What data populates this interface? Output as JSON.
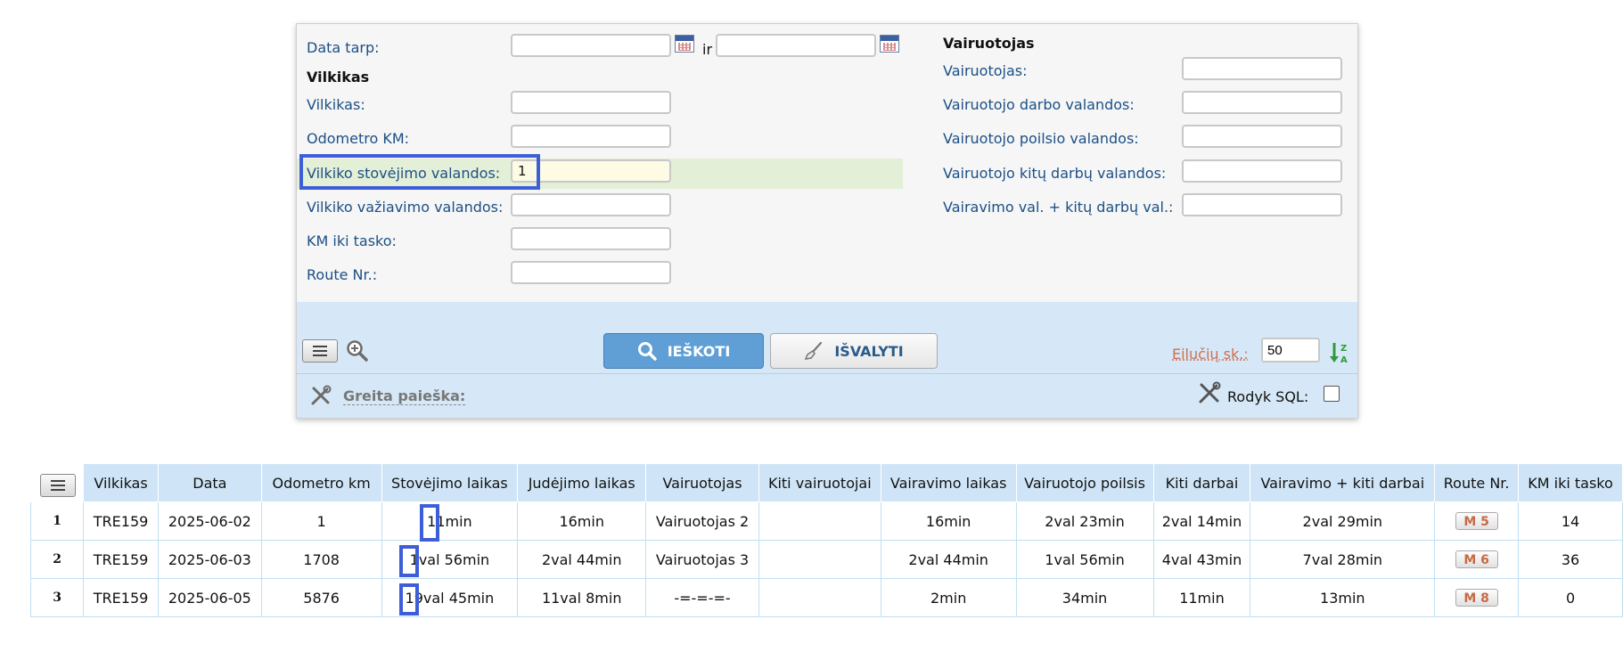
{
  "filters": {
    "date_between_label": "Data tarp:",
    "date_and_label": "ir",
    "date_from_value": "",
    "date_to_value": "",
    "truck_section": "Vilkikas",
    "truck_label": "Vilkikas:",
    "odometer_label": "Odometro KM:",
    "parking_hours_label": "Vilkiko stovėjimo valandos:",
    "parking_hours_value": "1",
    "driving_hours_label": "Vilkiko važiavimo valandos:",
    "km_to_point_label": "KM iki tasko:",
    "route_label": "Route Nr.:",
    "driver_section": "Vairuotojas",
    "driver_label": "Vairuotojas:",
    "driver_work_label": "Vairuotojo darbo valandos:",
    "driver_rest_label": "Vairuotojo poilsio valandos:",
    "driver_other_label": "Vairuotojo kitų darbų valandos:",
    "driving_plus_other_label": "Vairavimo val. + kitų darbų val.:"
  },
  "toolbar": {
    "search_label": "IEŠKOTI",
    "clear_label": "IŠVALYTI",
    "rows_label": "Eilučių sk.:",
    "rows_value": "50",
    "quick_search_label": "Greita paieška:",
    "show_sql_label": "Rodyk SQL:"
  },
  "table": {
    "headers": [
      "Vilkikas",
      "Data",
      "Odometro km",
      "Stovėjimo laikas",
      "Judėjimo laikas",
      "Vairuotojas",
      "Kiti vairuotojai",
      "Vairavimo laikas",
      "Vairuotojo poilsis",
      "Kiti darbai",
      "Vairavimo + kiti darbai",
      "Route Nr.",
      "KM iki tasko"
    ],
    "rows": [
      {
        "num": "1",
        "truck": "TRE159",
        "date": "2025-06-02",
        "odometer": "1",
        "parking": "11min",
        "moving": "16min",
        "driver": "Vairuotojas 2",
        "other_drivers": "",
        "driving": "16min",
        "rest": "2val 23min",
        "other_work": "2val 14min",
        "drive_plus_other": "2val 29min",
        "route": "M 5",
        "km_to_point": "14"
      },
      {
        "num": "2",
        "truck": "TRE159",
        "date": "2025-06-03",
        "odometer": "1708",
        "parking": "1val 56min",
        "moving": "2val 44min",
        "driver": "Vairuotojas 3",
        "other_drivers": "",
        "driving": "2val 44min",
        "rest": "1val 56min",
        "other_work": "4val 43min",
        "drive_plus_other": "7val 28min",
        "route": "M 6",
        "km_to_point": "36"
      },
      {
        "num": "3",
        "truck": "TRE159",
        "date": "2025-06-05",
        "odometer": "5876",
        "parking": "19val 45min",
        "moving": "11val 8min",
        "driver": "-=-=-=-",
        "other_drivers": "",
        "driving": "2min",
        "rest": "34min",
        "other_work": "11min",
        "drive_plus_other": "13min",
        "route": "M 8",
        "km_to_point": "0"
      }
    ]
  },
  "icons": {
    "menu": "hamburger-icon",
    "zoom": "zoom-in-icon",
    "search": "search-icon",
    "clear": "broom-icon",
    "sort": "sort-z-a-icon",
    "tools": "tools-icon",
    "calendar": "calendar-icon"
  },
  "colors": {
    "label_blue": "#1c4f86",
    "search_button": "#5f9fd6",
    "highlight_row": "#e3efd6",
    "focus_border": "#3e5ed8",
    "link_orange": "#d07a1e",
    "toolbar_bg": "#d6e8f7",
    "header_bg": "#cfe5f7"
  }
}
